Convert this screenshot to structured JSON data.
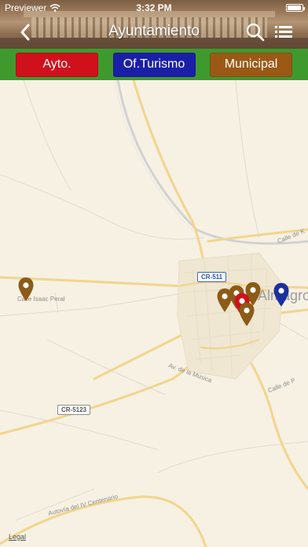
{
  "status_bar": {
    "carrier": "Previewer",
    "time": "3:32 PM"
  },
  "nav": {
    "title": "Ayuntamiento",
    "back_icon": "chevron-left-icon",
    "search_icon": "search-icon",
    "list_icon": "list-icon"
  },
  "filters": [
    {
      "label": "Ayto.",
      "color": "#d0111b"
    },
    {
      "label": "Of.Turismo",
      "color": "#1b1fa8"
    },
    {
      "label": "Municipal",
      "color": "#9a5a16"
    }
  ],
  "colors": {
    "filter_bar": "#3f9a2e",
    "pin_ayto": "#d0111b",
    "pin_turismo": "#1b2fa0",
    "pin_municipal": "#8c5b17"
  },
  "map": {
    "labels": {
      "calle_k": "Calle de K",
      "calle_isaac": "Calle Isaac Peral",
      "av_musica": "Av. de la Música",
      "calle_p": "Calle de P",
      "autovia": "Autovía del IV Centenario"
    },
    "shields": {
      "cr511": "CR-511",
      "cr5123": "CR-5123"
    },
    "town": "Almagro",
    "legal": "Legal"
  }
}
